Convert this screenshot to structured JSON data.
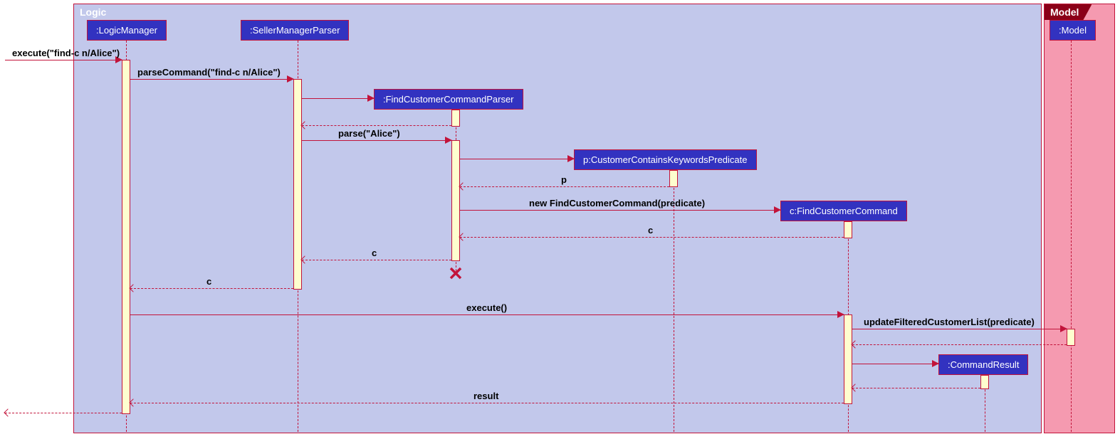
{
  "frames": {
    "logic": "Logic",
    "model": "Model"
  },
  "participants": {
    "logicManager": ":LogicManager",
    "sellerManagerParser": ":SellerManagerParser",
    "findCustomerCommandParser": ":FindCustomerCommandParser",
    "customerContainsKeywordsPredicate": "p:CustomerContainsKeywordsPredicate",
    "findCustomerCommand": "c:FindCustomerCommand",
    "commandResult": ":CommandResult",
    "model": ":Model"
  },
  "messages": {
    "execute_in": "execute(\"find-c n/Alice\")",
    "parseCommand": "parseCommand(\"find-c n/Alice\")",
    "parse": "parse(\"Alice\")",
    "p": "p",
    "newFindCustomerCommand": "new FindCustomerCommand(predicate)",
    "c": "c",
    "execute": "execute()",
    "updateFilteredCustomerList": "updateFilteredCustomerList(predicate)",
    "result": "result"
  }
}
